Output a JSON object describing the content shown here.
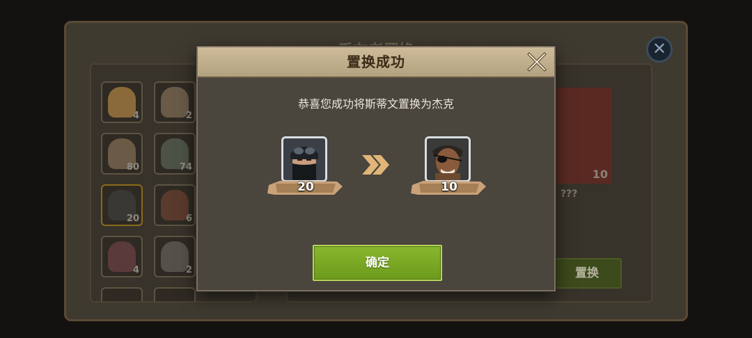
{
  "background": {
    "title": "丢在老置换",
    "tile_counts": [
      "4",
      "2",
      "80",
      "74",
      "20",
      "6",
      "4",
      "2"
    ],
    "right_card_count": "10",
    "right_card_label": "???",
    "swap_button_label": "置换"
  },
  "modal": {
    "title": "置换成功",
    "message": "恭喜您成功将斯蒂文置换为杰克",
    "from_hero": {
      "count": "20"
    },
    "to_hero": {
      "count": "10"
    },
    "confirm_label": "确定"
  },
  "colors": {
    "header": "#c4b18d",
    "modal_body": "#4a453d",
    "confirm_green": "#7aa926",
    "arrow_orange": "#e0b577",
    "ribbon": "#c9a27a"
  }
}
